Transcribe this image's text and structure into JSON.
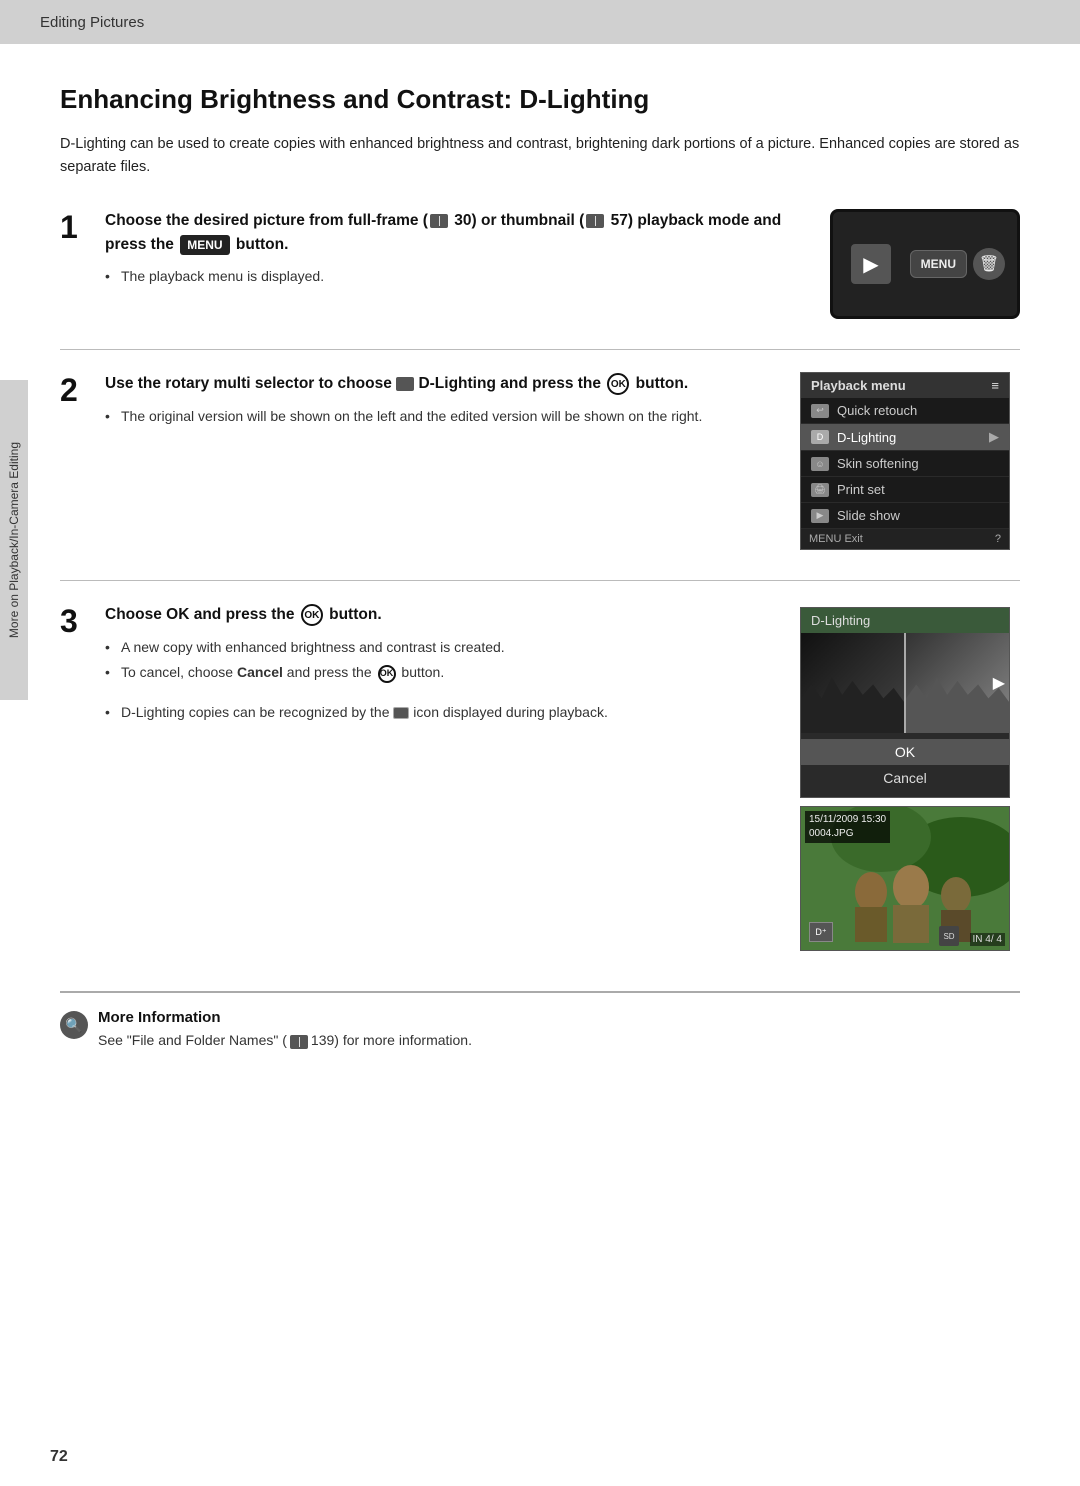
{
  "topBar": {
    "label": "Editing Pictures"
  },
  "sidebar": {
    "text": "More on Playback/In-Camera Editing"
  },
  "pageTitle": "Enhancing Brightness and Contrast: D-Lighting",
  "intro": "D-Lighting can be used to create copies with enhanced brightness and contrast, brightening dark portions of a picture. Enhanced copies are stored as separate files.",
  "steps": [
    {
      "number": "1",
      "heading": "Choose the desired picture from full-frame (  30) or thumbnail (  57) playback mode and press the MENU button.",
      "headingParts": {
        "before": "Choose the desired picture from full-frame",
        "bookRef1": "30",
        "mid": " or thumbnail (",
        "bookRef2": "57",
        "after": ") playback mode",
        "after2": "and press the",
        "menuBtn": "MENU",
        "after3": "button."
      },
      "bullets": [
        "The playback menu is displayed."
      ],
      "imageAlt": "camera menu button"
    },
    {
      "number": "2",
      "heading": "Use the rotary multi selector to choose D-Lighting and press the OK button.",
      "bullets": [
        "The original version will be shown on the left and the edited version will be shown on the right."
      ],
      "imageAlt": "playback menu screenshot"
    },
    {
      "number": "3",
      "heading": "Choose OK and press the OK button.",
      "bullets": [
        "A new copy with enhanced brightness and contrast is created.",
        "To cancel, choose Cancel and press the OK button."
      ],
      "bulletExtra": "D-Lighting copies can be recognized by the icon displayed during playback.",
      "imageAlt": "D-Lighting dialog"
    }
  ],
  "playbackMenu": {
    "header": "Playback menu",
    "items": [
      {
        "label": "Quick retouch",
        "icon": "retouch",
        "highlighted": false
      },
      {
        "label": "D-Lighting",
        "icon": "dlighting",
        "highlighted": true,
        "hasArrow": true
      },
      {
        "label": "Skin softening",
        "icon": "skin",
        "highlighted": false
      },
      {
        "label": "Print set",
        "icon": "print",
        "highlighted": false
      },
      {
        "label": "Slide show",
        "icon": "slide",
        "highlighted": false
      }
    ],
    "footer": "MENU Exit",
    "footerHelp": "?"
  },
  "dlightingPanel": {
    "header": "D-Lighting",
    "buttons": [
      "OK",
      "Cancel"
    ],
    "selectedButton": "OK"
  },
  "photoInfo": {
    "date": "15/11/2009 15:30",
    "filename": "0004.JPG",
    "counter": "IN 4/ 4"
  },
  "moreInfo": {
    "title": "More Information",
    "body": "See \"File and Folder Names\" (",
    "pageRef": "139",
    "bodyEnd": ") for more information."
  },
  "pageNumber": "72"
}
